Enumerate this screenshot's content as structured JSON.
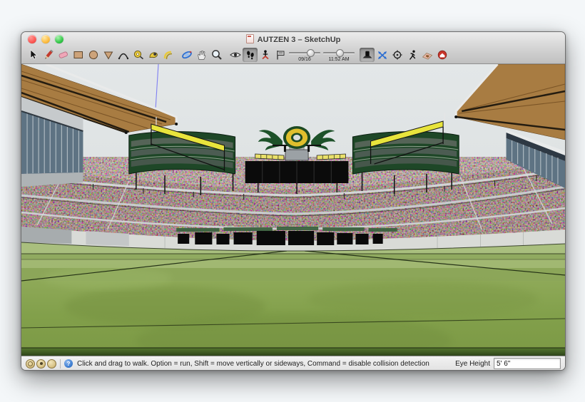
{
  "window": {
    "title": "AUTZEN 3 – SketchUp",
    "traffic_lights": [
      "close",
      "minimize",
      "zoom"
    ]
  },
  "toolbar": {
    "tools": [
      "select",
      "line",
      "eraser",
      "rectangle",
      "circle",
      "polygon",
      "arc",
      "tape-measure",
      "follow-me",
      "offset",
      "orbit",
      "pan",
      "zoom",
      "look-around",
      "walk",
      "position-camera",
      "shadows-flag"
    ],
    "active_tool": "walk",
    "shadows": {
      "date": "09/16",
      "time": "11:52 AM"
    },
    "right_tools": [
      "stage",
      "move-axes",
      "position-target",
      "run-walkthrough",
      "photo-texture",
      "3d-warehouse"
    ]
  },
  "viewport": {
    "model_name": "Autzen Stadium",
    "logo_letter": "O",
    "colors": {
      "sky": "#dde1e2",
      "field_green": "#7e9b46",
      "oregon_yellow": "#e0bf2d",
      "oregon_green": "#1d4a23",
      "beam_yellow": "#e8e43c",
      "roof_wood": "#a87c42"
    }
  },
  "statusbar": {
    "hint": "Click and drag to walk.  Option = run, Shift = move vertically or sideways, Command = disable collision detection",
    "eye_height_label": "Eye Height",
    "eye_height_value": "5' 6\""
  }
}
